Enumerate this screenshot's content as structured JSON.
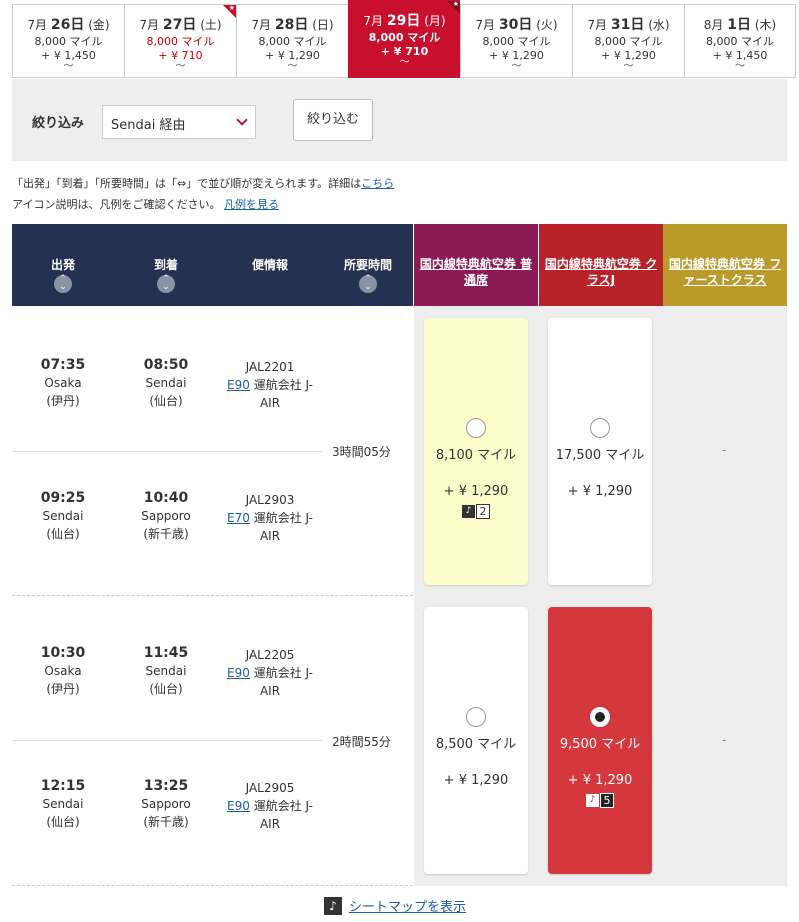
{
  "dates": [
    {
      "month": "7月",
      "day": "26日",
      "dow": "(金)",
      "miles": "8,000 マイル",
      "yen": "+ ¥ 1,450",
      "tilde": "～",
      "cheap": false,
      "active": false
    },
    {
      "month": "7月",
      "day": "27日",
      "dow": "(土)",
      "miles": "8,000 マイル",
      "yen": "+ ¥ 710",
      "tilde": "～",
      "cheap": true,
      "active": false
    },
    {
      "month": "7月",
      "day": "28日",
      "dow": "(日)",
      "miles": "8,000 マイル",
      "yen": "+ ¥ 1,290",
      "tilde": "～",
      "cheap": false,
      "active": false
    },
    {
      "month": "7月",
      "day": "29日",
      "dow": "(月)",
      "miles": "8,000 マイル",
      "yen": "+ ¥ 710",
      "tilde": "～",
      "cheap": true,
      "active": true
    },
    {
      "month": "7月",
      "day": "30日",
      "dow": "(火)",
      "miles": "8,000 マイル",
      "yen": "+ ¥ 1,290",
      "tilde": "～",
      "cheap": false,
      "active": false
    },
    {
      "month": "7月",
      "day": "31日",
      "dow": "(水)",
      "miles": "8,000 マイル",
      "yen": "+ ¥ 1,290",
      "tilde": "～",
      "cheap": false,
      "active": false
    },
    {
      "month": "8月",
      "day": "1日",
      "dow": "(木)",
      "miles": "8,000 マイル",
      "yen": "+ ¥ 1,450",
      "tilde": "～",
      "cheap": false,
      "active": false
    }
  ],
  "filter": {
    "label": "絞り込み",
    "selected": "Sendai 経由",
    "button": "絞り込む"
  },
  "notes": {
    "line1": "「出発」「到着」「所要時間」は「⇔」で並び順が変えられます。詳細は",
    "line1_link": "こちら",
    "line2": "アイコン説明は、凡例をご確認ください。",
    "line2_link": "凡例を見る"
  },
  "header": {
    "depart": "出発",
    "arrive": "到着",
    "flight": "便情報",
    "duration": "所要時間",
    "fare1": "国内線特典航空券 普通席",
    "fare2": "国内線特典航空券 クラスJ",
    "fare3": "国内線特典航空券 ファーストクラス"
  },
  "itineraries": [
    {
      "duration": "3時間05分",
      "segments": [
        {
          "dep_time": "07:35",
          "dep_city": "Osaka",
          "dep_airport": "(伊丹)",
          "arr_time": "08:50",
          "arr_city": "Sendai",
          "arr_airport": "(仙台)",
          "flight_no": "JAL2201",
          "aircraft": "E90",
          "operator": "運航会社 J-AIR"
        },
        {
          "dep_time": "09:25",
          "dep_city": "Sendai",
          "dep_airport": "(仙台)",
          "arr_time": "10:40",
          "arr_city": "Sapporo",
          "arr_airport": "(新千歳)",
          "flight_no": "JAL2903",
          "aircraft": "E70",
          "operator": "運航会社 J-AIR"
        }
      ],
      "fares": [
        {
          "miles": "8,100 マイル",
          "yen": "+ ¥ 1,290",
          "seats": "2",
          "selected": false
        },
        {
          "miles": "17,500 マイル",
          "yen": "+ ¥ 1,290",
          "seats": "",
          "selected": false
        }
      ],
      "first": "-"
    },
    {
      "duration": "2時間55分",
      "segments": [
        {
          "dep_time": "10:30",
          "dep_city": "Osaka",
          "dep_airport": "(伊丹)",
          "arr_time": "11:45",
          "arr_city": "Sendai",
          "arr_airport": "(仙台)",
          "flight_no": "JAL2205",
          "aircraft": "E90",
          "operator": "運航会社 J-AIR"
        },
        {
          "dep_time": "12:15",
          "dep_city": "Sendai",
          "dep_airport": "(仙台)",
          "arr_time": "13:25",
          "arr_city": "Sapporo",
          "arr_airport": "(新千歳)",
          "flight_no": "JAL2905",
          "aircraft": "E90",
          "operator": "運航会社 J-AIR"
        }
      ],
      "fares": [
        {
          "miles": "8,500 マイル",
          "yen": "+ ¥ 1,290",
          "seats": "",
          "selected": false
        },
        {
          "miles": "9,500 マイル",
          "yen": "+ ¥ 1,290",
          "seats": "5",
          "selected": true
        }
      ],
      "first": "-"
    }
  ],
  "footer": {
    "seatmap": "シートマップを表示"
  },
  "colors": {
    "accent": "#c8102e",
    "header_bg": "#253150",
    "fare1": "#8b1a55",
    "fare2": "#b8232a",
    "fare3": "#b99a2b"
  }
}
